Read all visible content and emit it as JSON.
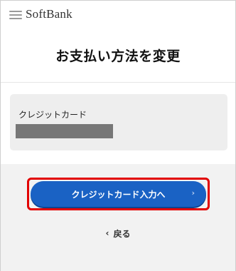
{
  "header": {
    "logo": "SoftBank",
    "menu_icon": "hamburger-menu-icon"
  },
  "page": {
    "title": "お支払い方法を変更"
  },
  "card": {
    "label": "クレジットカード",
    "masked_number": ""
  },
  "actions": {
    "primary_label": "クレジットカード入力へ",
    "primary_chevron": "›",
    "back_chevron": "‹",
    "back_label": "戻る"
  },
  "colors": {
    "accent": "#1a62c4",
    "highlight": "#e20000",
    "card_bg": "#eeeeee",
    "footer_bg": "#f2f2f2"
  }
}
